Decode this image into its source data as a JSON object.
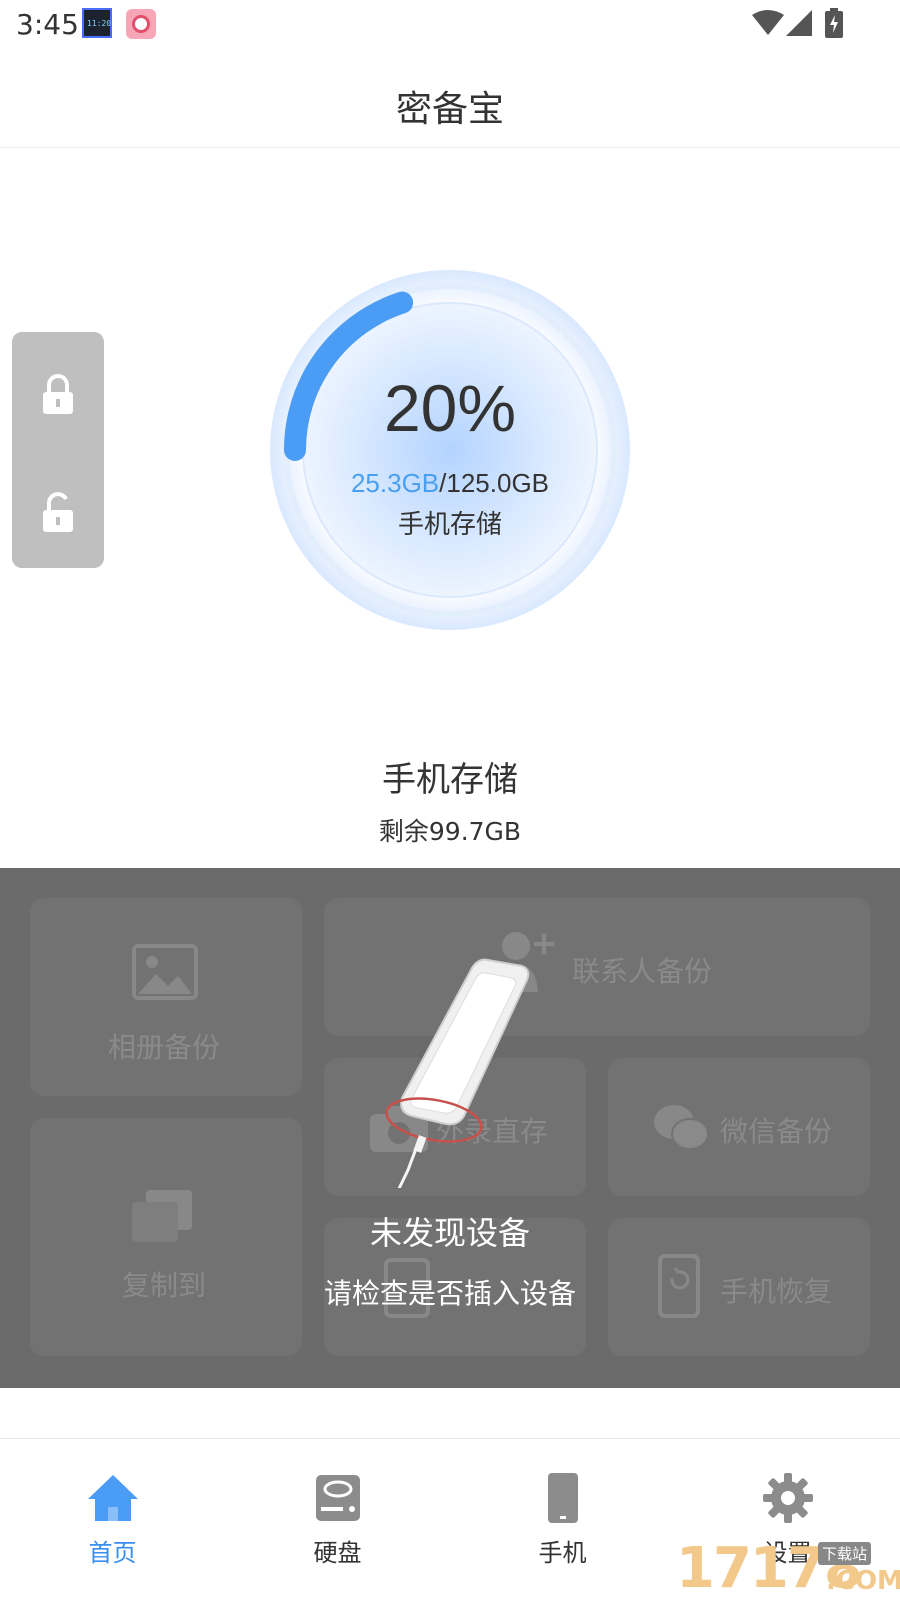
{
  "status_bar": {
    "time": "3:45"
  },
  "app": {
    "title": "密备宝"
  },
  "gauge": {
    "percent_label": "20%",
    "used": "25.3GB",
    "separator": "/",
    "total": "125.0GB",
    "label": "手机存储",
    "fill_fraction": 0.2
  },
  "storage": {
    "title": "手机存储",
    "free": "剩余99.7GB"
  },
  "functions": {
    "photo_backup": "相册备份",
    "contact_backup": "联系人备份",
    "record_direct": "外录直存",
    "wechat_backup": "微信备份",
    "copy_to": "复制到",
    "phone_restore": "手机恢复"
  },
  "no_device": {
    "title": "未发现设备",
    "message": "请检查是否插入设备"
  },
  "bottom_nav": {
    "home": "首页",
    "disk": "硬盘",
    "phone": "手机",
    "settings": "设置"
  },
  "colors": {
    "accent": "#3a8ef0",
    "overlay": "#6b6b6b"
  },
  "watermark": {
    "digits": "17178",
    "sub": "下载站",
    "domain": ".COM"
  }
}
